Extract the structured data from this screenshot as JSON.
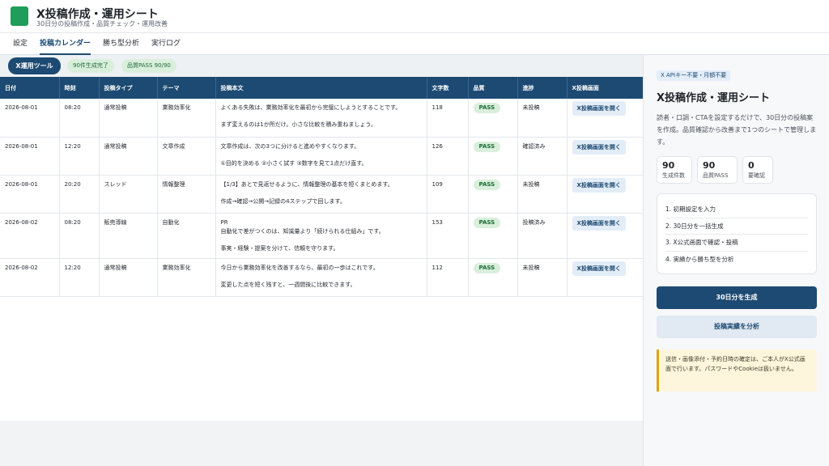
{
  "header": {
    "title": "X投稿作成・運用シート",
    "subtitle": "30日分の投稿作成・品質チェック・運用改善"
  },
  "tabs": [
    {
      "label": "設定",
      "active": false
    },
    {
      "label": "投稿カレンダー",
      "active": true
    },
    {
      "label": "勝ち型分析",
      "active": false
    },
    {
      "label": "実行ログ",
      "active": false
    }
  ],
  "toolbar": {
    "tool_button": "X運用ツール",
    "generated": "90件生成完了",
    "quality": "品質PASS 90/90"
  },
  "table": {
    "columns": [
      "日付",
      "時刻",
      "投稿タイプ",
      "テーマ",
      "投稿本文",
      "文字数",
      "品質",
      "進捗",
      "X投稿画面"
    ],
    "rows": [
      {
        "date": "2026-08-01",
        "time": "08:20",
        "type": "通常投稿",
        "theme": "業務効率化",
        "body": [
          "よくある失敗は、業務効率化を最初から完璧にしようとすることです。",
          "まず変えるのは1か所だけ。小さな比較を積み重ねましょう。"
        ],
        "chars": "118",
        "quality": "PASS",
        "progress": "未投稿",
        "open": "X投稿画面を開く"
      },
      {
        "date": "2026-08-01",
        "time": "12:20",
        "type": "通常投稿",
        "theme": "文章作成",
        "body": [
          "文章作成は、次の3つに分けると進めやすくなります。",
          "①目的を決める ②小さく試す ③数字を見て1点だけ直す。"
        ],
        "chars": "126",
        "quality": "PASS",
        "progress": "確認済み",
        "open": "X投稿画面を開く"
      },
      {
        "date": "2026-08-01",
        "time": "20:20",
        "type": "スレッド",
        "theme": "情報整理",
        "body": [
          "【1/3】あとで見返せるように、情報整理の基本を短くまとめます。",
          "作成→確認→公開→記録の4ステップで回します。"
        ],
        "chars": "109",
        "quality": "PASS",
        "progress": "未投稿",
        "open": "X投稿画面を開く"
      },
      {
        "date": "2026-08-02",
        "time": "08:20",
        "type": "販売導線",
        "theme": "自動化",
        "body": [
          "PR\n自動化で差がつくのは、知識量より「続けられる仕組み」です。",
          "事実・経験・提案を分けて、信頼を守ります。"
        ],
        "chars": "153",
        "quality": "PASS",
        "progress": "投稿済み",
        "open": "X投稿画面を開く"
      },
      {
        "date": "2026-08-02",
        "time": "12:20",
        "type": "通常投稿",
        "theme": "業務効率化",
        "body": [
          "今日から業務効率化を改善するなら、最初の一歩はこれです。",
          "変更した点を短く残すと、一週間後に比較できます。"
        ],
        "chars": "112",
        "quality": "PASS",
        "progress": "未投稿",
        "open": "X投稿画面を開く"
      }
    ]
  },
  "side": {
    "badge": "X APIキー不要・月額不要",
    "title": "X投稿作成・運用シート",
    "description": "読者・口調・CTAを設定するだけで、30日分の投稿案を作成。品質確認から改善まで1つのシートで管理します。",
    "stats": [
      {
        "value": "90",
        "label": "生成件数"
      },
      {
        "value": "90",
        "label": "品質PASS"
      },
      {
        "value": "0",
        "label": "要確認"
      }
    ],
    "steps": [
      "1. 初期設定を入力",
      "2. 30日分を一括生成",
      "3. X公式画面で確認・投稿",
      "4. 実績から勝ち型を分析"
    ],
    "generate_button": "30日分を生成",
    "analyze_button": "投稿実績を分析",
    "notice": "送信・画像添付・予約日時の確定は、ご本人がX公式画面で行います。パスワードやCookieは扱いません。"
  },
  "colors": {
    "primary": "#1d4a72",
    "pass_bg": "#d9efdc",
    "pass_text": "#1e6b34",
    "logo": "#1e9e5a",
    "notice_border": "#e2a414"
  }
}
